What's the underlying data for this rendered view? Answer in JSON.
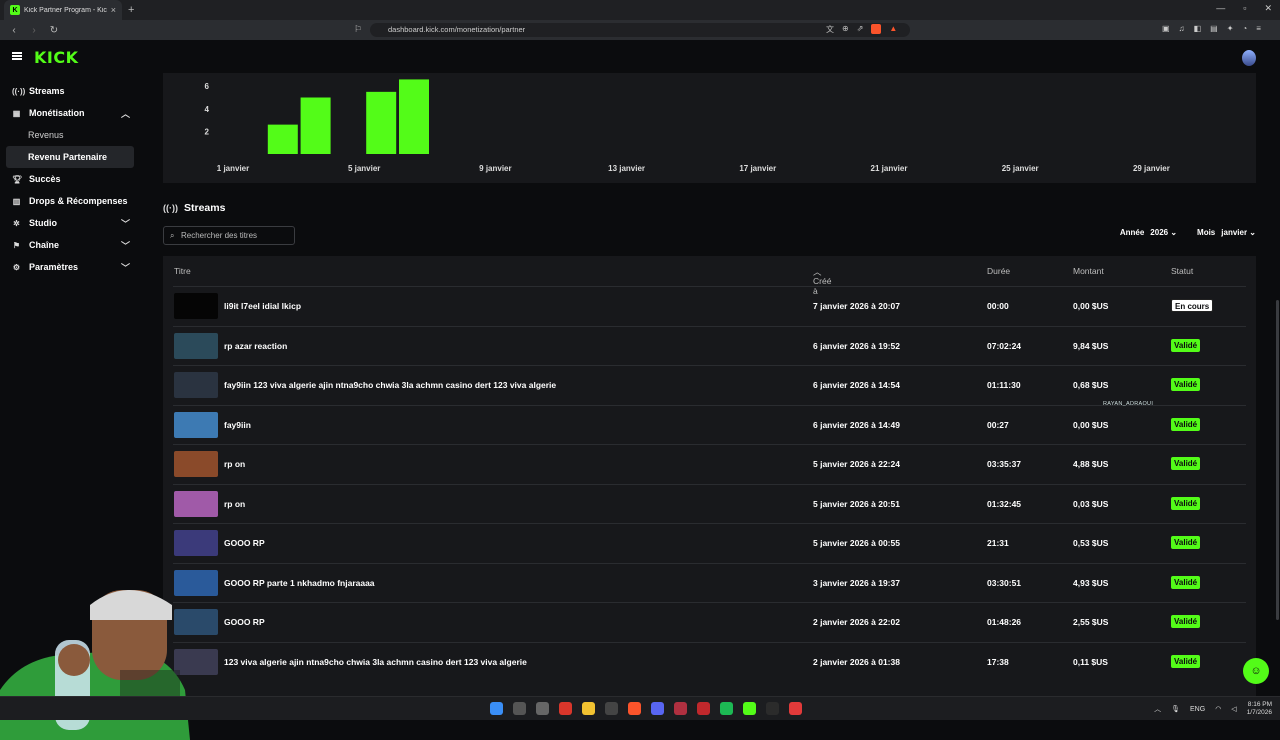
{
  "browser": {
    "tab_title": "Kick Partner Program - Kick Dash",
    "url": "dashboard.kick.com/monetization/partner"
  },
  "app": {
    "logo": "KICK"
  },
  "sidebar": {
    "items": [
      {
        "label": "Streams",
        "icon": "broadcast-icon"
      },
      {
        "label": "Monétisation",
        "icon": "money-icon"
      },
      {
        "label": "Revenus",
        "sub": true
      },
      {
        "label": "Revenu Partenaire",
        "sub": true,
        "active": true
      },
      {
        "label": "Succès",
        "icon": "trophy-icon"
      },
      {
        "label": "Drops & Récompenses",
        "icon": "gift-icon"
      },
      {
        "label": "Studio",
        "icon": "gear-icon"
      },
      {
        "label": "Chaîne",
        "icon": "channel-icon"
      },
      {
        "label": "Paramètres",
        "icon": "settings-icon"
      }
    ]
  },
  "chart_data": {
    "type": "bar",
    "x_ticks": [
      "1 janvier",
      "5 janvier",
      "9 janvier",
      "13 janvier",
      "17 janvier",
      "21 janvier",
      "25 janvier",
      "29 janvier"
    ],
    "y_ticks": [
      2,
      4,
      6
    ],
    "bars": [
      {
        "date": "2 janvier",
        "value": 2.6
      },
      {
        "date": "3 janvier",
        "value": 5.0
      },
      {
        "date": "5 janvier",
        "value": 5.5
      },
      {
        "date": "6 janvier",
        "value": 6.6
      }
    ],
    "color": "#53fc18"
  },
  "streams": {
    "heading": "Streams",
    "search_placeholder": "Rechercher des titres",
    "year_label": "Année",
    "year_value": "2026",
    "month_label": "Mois",
    "month_value": "janvier",
    "columns": {
      "title": "Titre",
      "created": "Créé à",
      "duration": "Durée",
      "amount": "Montant",
      "status": "Statut"
    },
    "rows": [
      {
        "title": "li9it l7eel idial lkicp",
        "created": "7 janvier 2026 à 20:07",
        "duration": "00:00",
        "amount": "0,00 $US",
        "status": "En cours",
        "live": true,
        "thumb": "#050505"
      },
      {
        "title": "rp azar reaction",
        "created": "6 janvier 2026 à 19:52",
        "duration": "07:02:24",
        "amount": "9,84 $US",
        "status": "Validé",
        "thumb": "#2b4a5a"
      },
      {
        "title": "fay9iin 123 viva algerie ajin ntna9cho chwia 3la achmn casino dert 123 viva algerie",
        "created": "6 janvier 2026 à 14:54",
        "duration": "01:11:30",
        "amount": "0,68 $US",
        "status": "Validé",
        "thumb": "#2a3340"
      },
      {
        "title": "fay9iin",
        "created": "6 janvier 2026 à 14:49",
        "duration": "00:27",
        "amount": "0,00 $US",
        "status": "Validé",
        "thumb": "#3d7ab3"
      },
      {
        "title": "rp on",
        "created": "5 janvier 2026 à 22:24",
        "duration": "03:35:37",
        "amount": "4,88 $US",
        "status": "Validé",
        "thumb": "#8a4a2a"
      },
      {
        "title": "rp on",
        "created": "5 janvier 2026 à 20:51",
        "duration": "01:32:45",
        "amount": "0,03 $US",
        "status": "Validé",
        "thumb": "#a05aa8"
      },
      {
        "title": "GOOO RP",
        "created": "5 janvier 2026 à 00:55",
        "duration": "21:31",
        "amount": "0,53 $US",
        "status": "Validé",
        "thumb": "#3b3a7a"
      },
      {
        "title": "GOOO RP parte 1 nkhadmo fnjaraaaa",
        "created": "3 janvier 2026 à 19:37",
        "duration": "03:30:51",
        "amount": "4,93 $US",
        "status": "Validé",
        "thumb": "#2a5a9a"
      },
      {
        "title": "GOOO RP",
        "created": "2 janvier 2026 à 22:02",
        "duration": "01:48:26",
        "amount": "2,55 $US",
        "status": "Validé",
        "thumb": "#2a4a6a"
      },
      {
        "title": "123 viva algerie ajin ntna9cho chwia 3la achmn casino dert 123 viva algerie",
        "created": "2 janvier 2026 à 01:38",
        "duration": "17:38",
        "amount": "0,11 $US",
        "status": "Validé",
        "thumb": "#3a3a50"
      }
    ]
  },
  "overlay_tag": "RAYAN_ADRAOUI",
  "taskbar": {
    "lang": "ENG",
    "time": "8:16 PM",
    "date": "1/7/2026"
  }
}
